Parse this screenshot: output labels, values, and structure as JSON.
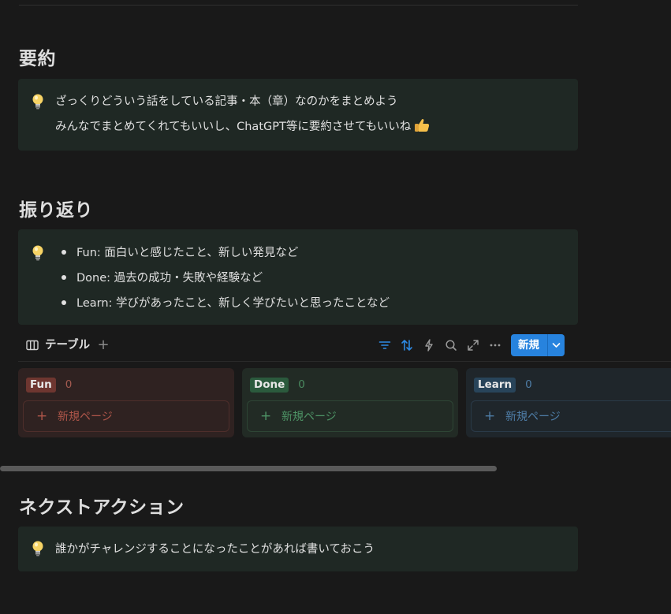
{
  "sections": {
    "summary": {
      "heading": "要約",
      "callout": {
        "icon": "lightbulb-icon",
        "line1": "ざっくりどういう話をしている記事・本（章）なのかをまとめよう",
        "line2": "みんなでまとめてくれてもいいし、ChatGPT等に要約させてもいいね",
        "emoji": "thumbs-up-icon"
      }
    },
    "reflection": {
      "heading": "振り返り",
      "callout": {
        "icon": "lightbulb-icon",
        "bullets": [
          "Fun: 面白いと感じたこと、新しい発見など",
          "Done: 過去の成功・失敗や経験など",
          "Learn: 学びがあったこと、新しく学びたいと思ったことなど"
        ]
      }
    },
    "next": {
      "heading": "ネクストアクション",
      "callout": {
        "icon": "lightbulb-icon",
        "line1": "誰かがチャレンジすることになったことがあれば書いておこう"
      }
    }
  },
  "board": {
    "view_tab_label": "テーブル",
    "new_button_label": "新規",
    "toolbar_icons": [
      "filter-icon",
      "sort-icon",
      "automation-icon",
      "search-icon",
      "expand-icon",
      "more-icon"
    ],
    "columns": [
      {
        "name": "Fun",
        "count": "0",
        "new_page_label": "新規ページ",
        "color": "#6e3630"
      },
      {
        "name": "Done",
        "count": "0",
        "new_page_label": "新規ページ",
        "color": "#2b5a3d"
      },
      {
        "name": "Learn",
        "count": "0",
        "new_page_label": "新規ページ",
        "color": "#28445a"
      }
    ]
  },
  "colors": {
    "background": "#191919",
    "callout": "#1f2824",
    "accent": "#2783de"
  }
}
